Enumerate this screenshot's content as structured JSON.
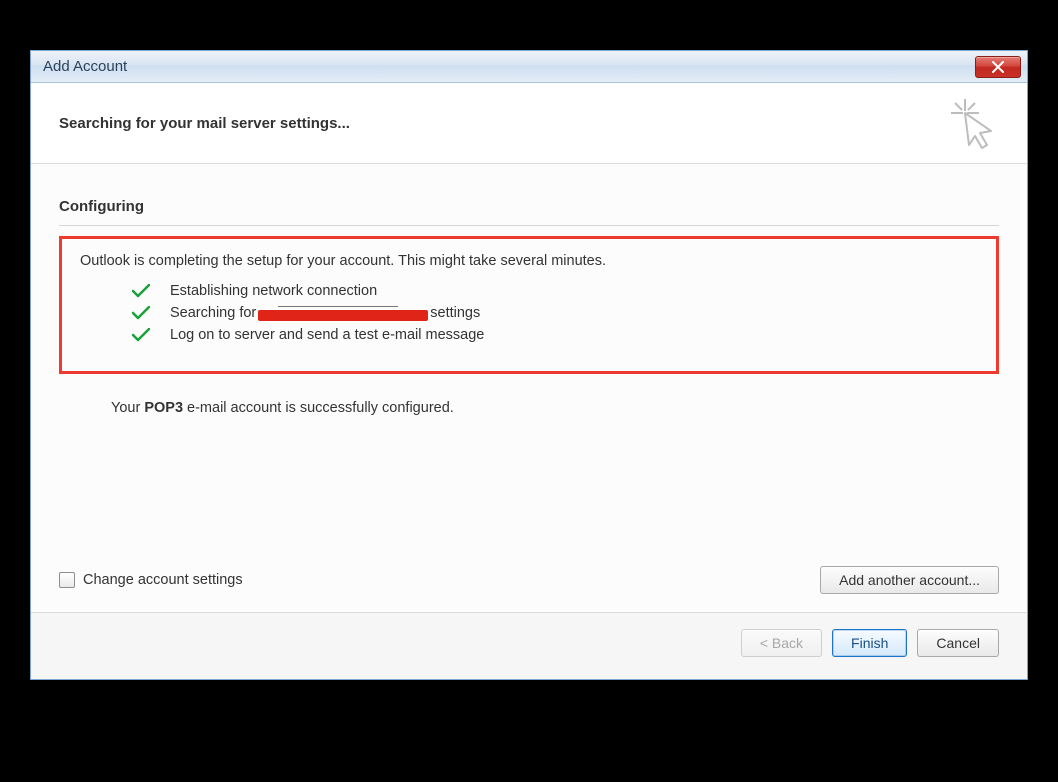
{
  "window": {
    "title": "Add Account"
  },
  "header": {
    "title": "Searching for your mail server settings..."
  },
  "section": {
    "label": "Configuring"
  },
  "intro": "Outlook is completing the setup for your account. This might take several minutes.",
  "steps": {
    "s1": "Establishing network connection",
    "s2_prefix": "Searching for ",
    "s2_suffix": " settings",
    "s3": "Log on to server and send a test e-mail message"
  },
  "success": {
    "prefix": "Your ",
    "protocol": "POP3",
    "suffix": " e-mail account is successfully configured."
  },
  "options": {
    "change_label": "Change account settings",
    "add_another": "Add another account..."
  },
  "footer": {
    "back": "< Back",
    "finish": "Finish",
    "cancel": "Cancel"
  }
}
